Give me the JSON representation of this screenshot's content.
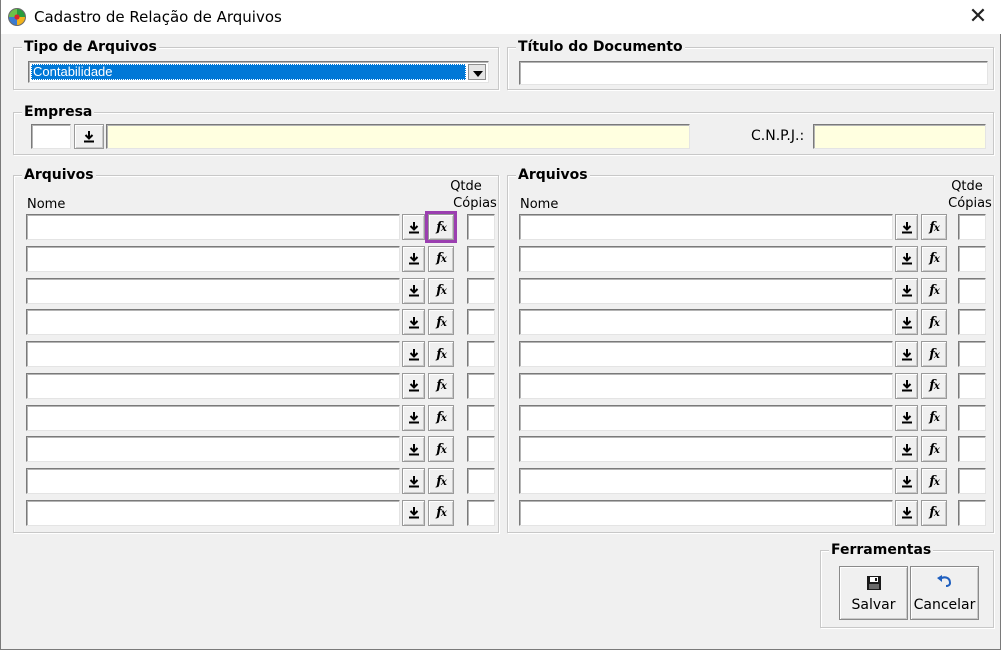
{
  "window": {
    "title": "Cadastro de Relação de Arquivos",
    "close_glyph": "✕",
    "icon": "app-logo-icon"
  },
  "tipo_arquivos": {
    "legend": "Tipo de Arquivos",
    "selected": "Contabilidade"
  },
  "titulo_documento": {
    "legend": "Título do Documento",
    "value": ""
  },
  "empresa": {
    "legend": "Empresa",
    "code": "",
    "name": "",
    "cnpj_label": "C.N.P.J.:",
    "cnpj": ""
  },
  "arquivos_left": {
    "legend": "Arquivos",
    "nome_label": "Nome",
    "qtde_label": "Qtde",
    "copias_label": "Cópias",
    "rows": [
      {
        "nome": "",
        "qtde": ""
      },
      {
        "nome": "",
        "qtde": ""
      },
      {
        "nome": "",
        "qtde": ""
      },
      {
        "nome": "",
        "qtde": ""
      },
      {
        "nome": "",
        "qtde": ""
      },
      {
        "nome": "",
        "qtde": ""
      },
      {
        "nome": "",
        "qtde": ""
      },
      {
        "nome": "",
        "qtde": ""
      },
      {
        "nome": "",
        "qtde": ""
      },
      {
        "nome": "",
        "qtde": ""
      }
    ]
  },
  "arquivos_right": {
    "legend": "Arquivos",
    "nome_label": "Nome",
    "qtde_label": "Qtde",
    "copias_label": "Cópias",
    "rows": [
      {
        "nome": "",
        "qtde": ""
      },
      {
        "nome": "",
        "qtde": ""
      },
      {
        "nome": "",
        "qtde": ""
      },
      {
        "nome": "",
        "qtde": ""
      },
      {
        "nome": "",
        "qtde": ""
      },
      {
        "nome": "",
        "qtde": ""
      },
      {
        "nome": "",
        "qtde": ""
      },
      {
        "nome": "",
        "qtde": ""
      },
      {
        "nome": "",
        "qtde": ""
      },
      {
        "nome": "",
        "qtde": ""
      }
    ]
  },
  "ferramentas": {
    "legend": "Ferramentas",
    "salvar_label": "Salvar",
    "cancelar_label": "Cancelar"
  },
  "icons": {
    "download": "download-arrow-icon",
    "fx": "fx-function-icon",
    "fx_text": "f",
    "fx_sub": "x",
    "save": "floppy-disk-icon",
    "cancel": "undo-arrow-icon"
  },
  "colors": {
    "selection": "#0078d7",
    "readonly_field": "#ffffe0",
    "highlight": "#9b3fb0"
  }
}
